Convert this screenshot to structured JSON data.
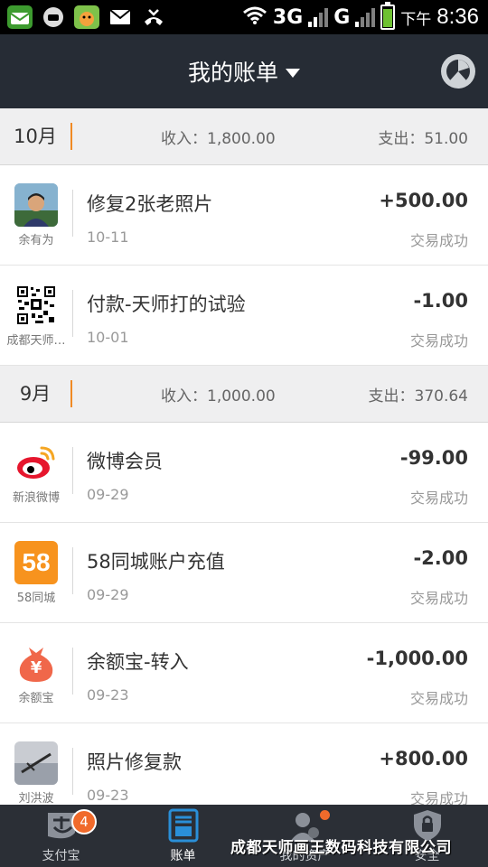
{
  "status_bar": {
    "network_1": "3G",
    "network_2": "G",
    "ampm": "下午",
    "time": "8:36"
  },
  "header": {
    "title": "我的账单"
  },
  "groups": [
    {
      "month": "10月",
      "income": "收入：1,800.00",
      "expense": "支出：51.00",
      "items": [
        {
          "icon": "avatar-photo",
          "caption": "余有为",
          "title": "修复2张老照片",
          "date": "10-11",
          "amount": "+500.00",
          "status": "交易成功"
        },
        {
          "icon": "qr-code",
          "caption": "成都天师…",
          "title": "付款-天师打的试验",
          "date": "10-01",
          "amount": "-1.00",
          "status": "交易成功"
        }
      ]
    },
    {
      "month": "9月",
      "income": "收入：1,000.00",
      "expense": "支出：370.64",
      "items": [
        {
          "icon": "weibo-logo",
          "caption": "新浪微博",
          "title": "微博会员",
          "date": "09-29",
          "amount": "-99.00",
          "status": "交易成功"
        },
        {
          "icon": "58-logo",
          "logo_text": "58",
          "caption": "58同城",
          "title": "58同城账户充值",
          "date": "09-29",
          "amount": "-2.00",
          "status": "交易成功"
        },
        {
          "icon": "yuebao-logo",
          "logo_text": "¥",
          "caption": "余额宝",
          "title": "余额宝-转入",
          "date": "09-23",
          "amount": "-1,000.00",
          "status": "交易成功"
        },
        {
          "icon": "avatar-photo",
          "caption": "刘洪波",
          "title": "照片修复款",
          "date": "09-23",
          "amount": "+800.00",
          "status": "交易成功"
        }
      ]
    }
  ],
  "tabs": [
    {
      "label": "支付宝",
      "icon": "alipay-icon",
      "badge": "4"
    },
    {
      "label": "账单",
      "icon": "bill-icon",
      "active": true
    },
    {
      "label": "我的资产",
      "icon": "assets-icon"
    },
    {
      "label": "安全",
      "icon": "security-icon"
    }
  ],
  "watermark": "成都天师画王数码科技有限公司",
  "colors": {
    "header_bg": "#262c35",
    "accent_orange": "#f08a24",
    "tab_active": "#2a8fd8",
    "badge": "#f06a2b"
  }
}
